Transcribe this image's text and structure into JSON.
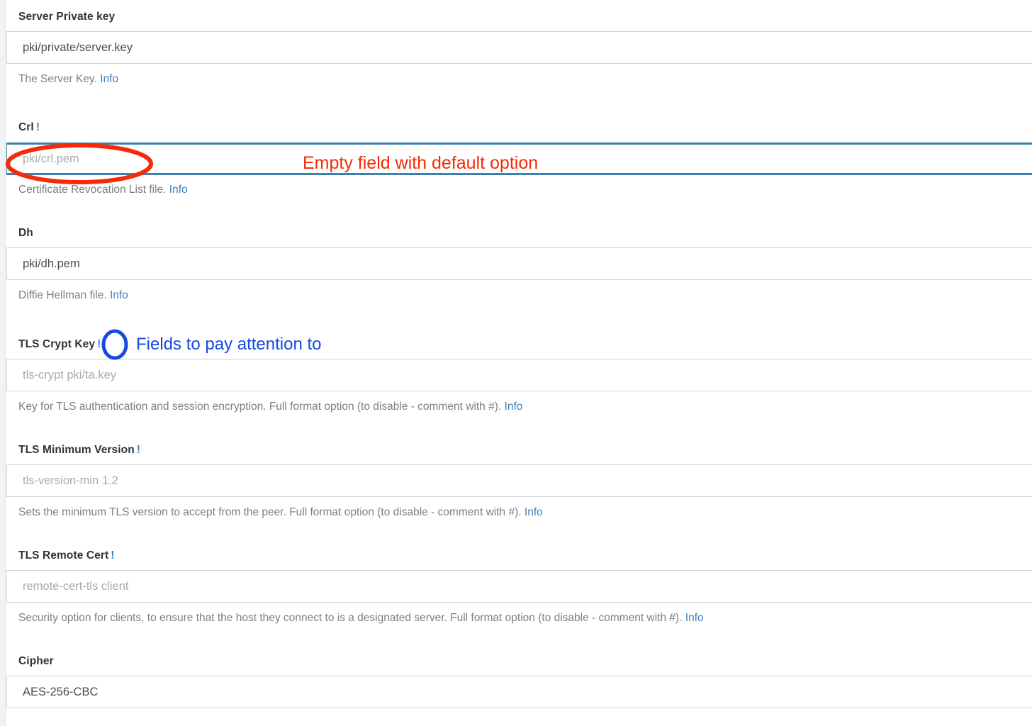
{
  "page": {
    "title": "OpenVPN TLS / PKI configuration form"
  },
  "colors": {
    "accent_blue": "#3e7fbf",
    "focus_border_blue": "#3a82ad",
    "annotation_red": "#f42a08",
    "annotation_blue": "#1549e4",
    "label_text": "#2e3338",
    "help_text": "#7b7f85",
    "placeholder_text": "#a8aaad",
    "value_text": "#4d4d4d",
    "field_border": "#ccd1d9",
    "gutter": "#f1f2f4"
  },
  "fields": [
    {
      "label": "Server Private key",
      "marker": "",
      "value": "pki/private/server.key",
      "placeholder": "",
      "is_placeholder": false,
      "focused": false,
      "help": "The Server Key.",
      "info_label": "Info"
    },
    {
      "label": "Crl",
      "marker": "!",
      "value": "",
      "placeholder": "pki/crl.pem",
      "is_placeholder": true,
      "focused": true,
      "help": "Certificate Revocation List file.",
      "info_label": "Info"
    },
    {
      "label": "Dh",
      "marker": "",
      "value": "pki/dh.pem",
      "placeholder": "",
      "is_placeholder": false,
      "focused": false,
      "help": "Diffie Hellman file.",
      "info_label": "Info"
    },
    {
      "label": "TLS Crypt Key",
      "marker": "!",
      "value": "",
      "placeholder": "tls-crypt pki/ta.key",
      "is_placeholder": true,
      "focused": false,
      "help": "Key for TLS authentication and session encryption. Full format option (to disable - comment with #).",
      "info_label": "Info"
    },
    {
      "label": "TLS Minimum Version",
      "marker": "!",
      "value": "",
      "placeholder": "tls-version-min 1.2",
      "is_placeholder": true,
      "focused": false,
      "help": "Sets the minimum TLS version to accept from the peer. Full format option (to disable - comment with #).",
      "info_label": "Info"
    },
    {
      "label": "TLS Remote Cert",
      "marker": "!",
      "value": "",
      "placeholder": "remote-cert-tls client",
      "is_placeholder": true,
      "focused": false,
      "help": "Security option for clients, to ensure that the host they connect to is a designated server. Full format option (to disable - comment with #).",
      "info_label": "Info"
    },
    {
      "label": "Cipher",
      "marker": "",
      "value": "AES-256-CBC",
      "placeholder": "",
      "is_placeholder": false,
      "focused": false,
      "help": "",
      "info_label": ""
    }
  ],
  "annotations": {
    "red": {
      "text": "Empty field with default option",
      "color": "#f42a08",
      "shape": "ellipse",
      "target": "crl-input-placeholder"
    },
    "blue": {
      "text": "Fields to pay attention to",
      "color": "#1549e4",
      "shape": "ellipse",
      "target": "tls-crypt-key-marker"
    }
  }
}
